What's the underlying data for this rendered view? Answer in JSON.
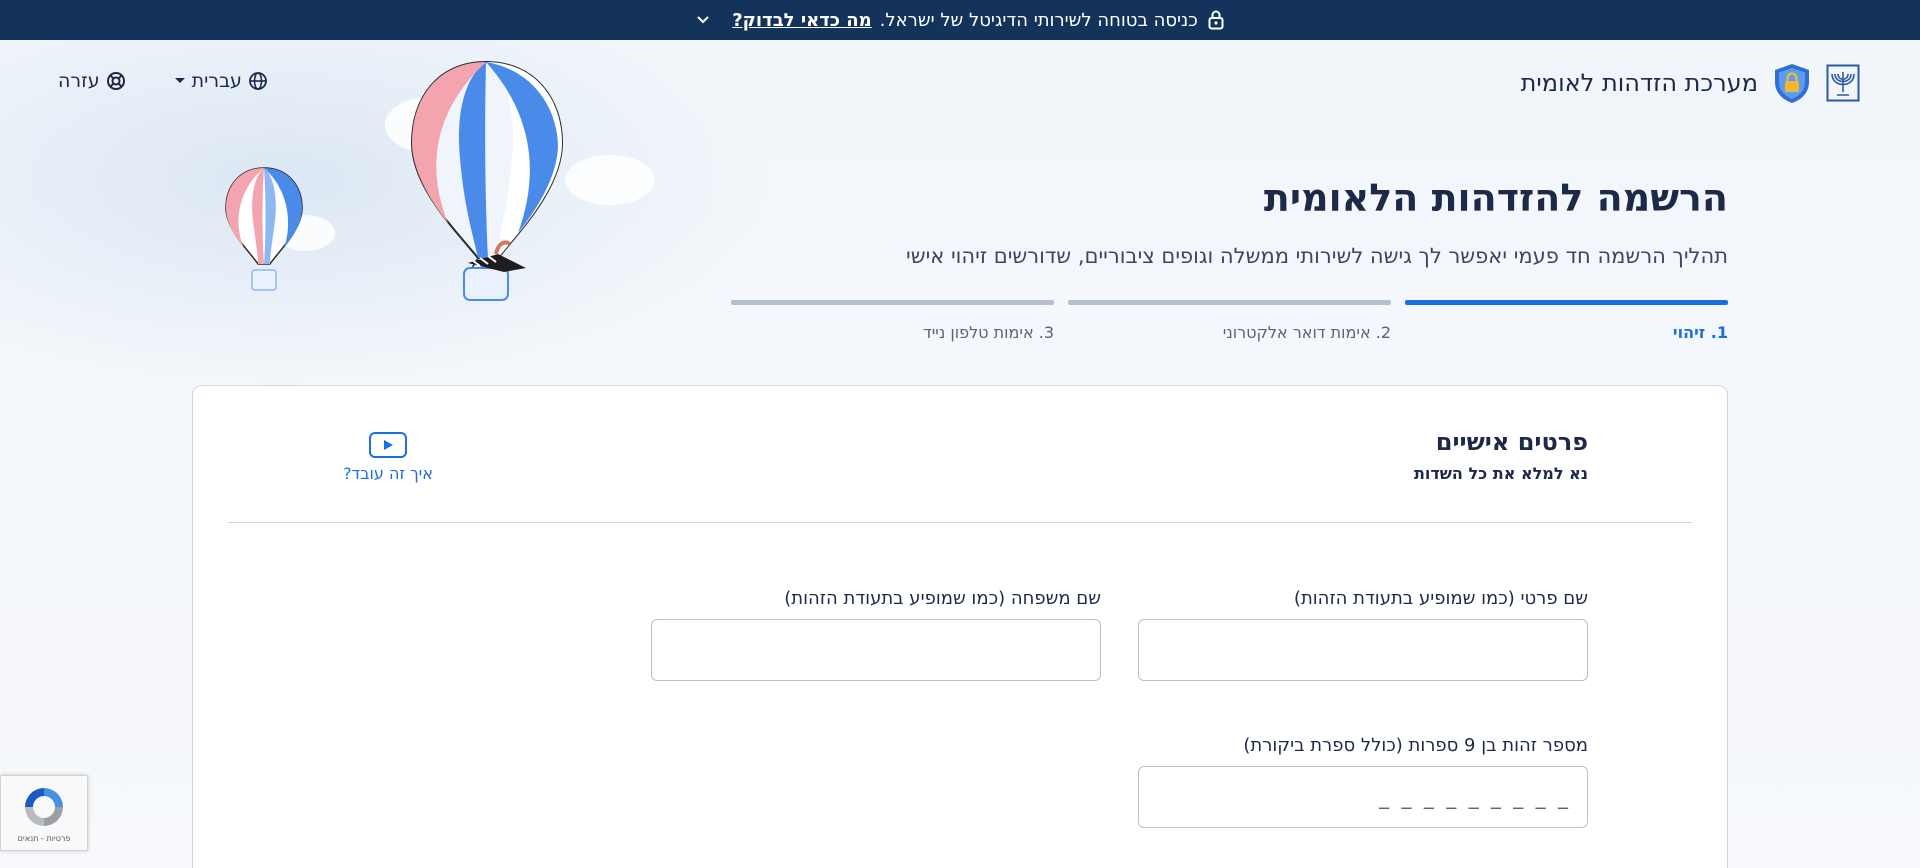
{
  "banner": {
    "text": "כניסה בטוחה לשירותי הדיגיטל של ישראל.",
    "link": "מה כדאי לבדוק?"
  },
  "header": {
    "brand": "מערכת הזדהות לאומית",
    "language": "עברית",
    "help": "עזרה"
  },
  "hero": {
    "title": "הרשמה להזדהות הלאומית",
    "subtitle": "תהליך הרשמה חד פעמי יאפשר לך גישה לשירותי ממשלה וגופים ציבוריים, שדורשים זיהוי אישי"
  },
  "steps": [
    {
      "label": "1. זיהוי",
      "active": true
    },
    {
      "label": "2. אימות דואר אלקטרוני",
      "active": false
    },
    {
      "label": "3. אימות טלפון נייד",
      "active": false
    }
  ],
  "form": {
    "title": "פרטים אישיים",
    "subtitle": "נא למלא את כל השדות",
    "how_it_works": "איך זה עובד?",
    "fields": {
      "first_name": {
        "label": "שם פרטי (כמו שמופיע בתעודת הזהות)",
        "value": "",
        "placeholder": ""
      },
      "last_name": {
        "label": "שם משפחה (כמו שמופיע בתעודת הזהות)",
        "value": "",
        "placeholder": ""
      },
      "id_number": {
        "label": "מספר זהות בן 9 ספרות (כולל ספרת ביקורת)",
        "value": "",
        "placeholder": "_ _ _ _ _ _ _ _ _"
      }
    }
  },
  "recaptcha": {
    "text": "פרטיות - תנאים"
  },
  "colors": {
    "banner": "#13335a",
    "accent": "#1a6fe2",
    "text": "#1c2a48"
  }
}
